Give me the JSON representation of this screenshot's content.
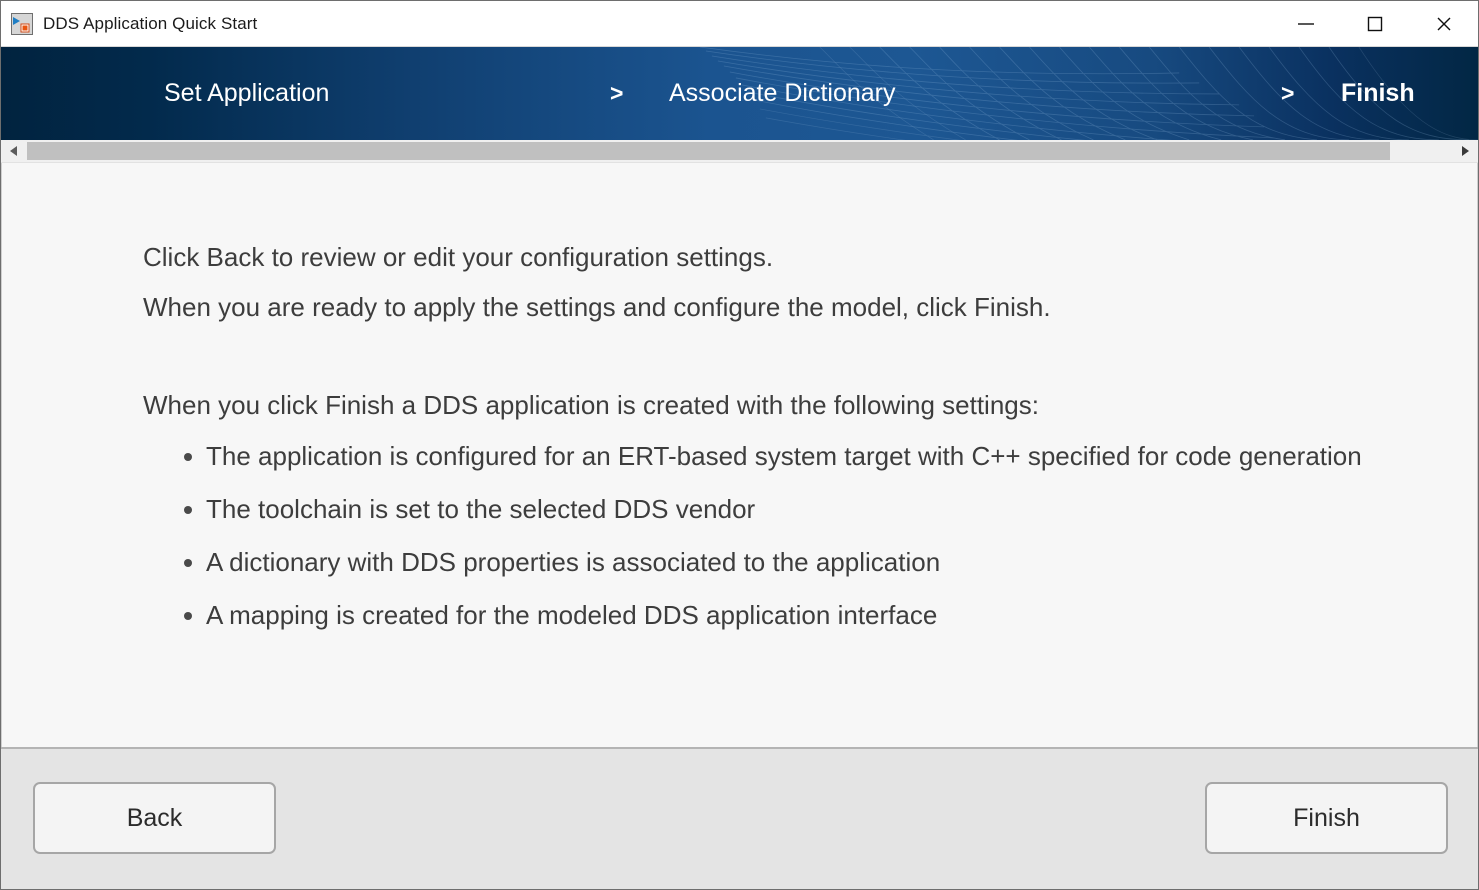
{
  "window": {
    "title": "DDS Application Quick Start",
    "icon": "simulink-block-icon",
    "controls": [
      {
        "name": "minimize-button",
        "label": "—"
      },
      {
        "name": "maximize-button",
        "label": "□"
      },
      {
        "name": "close-button",
        "label": "✕"
      }
    ]
  },
  "banner": {
    "steps": [
      {
        "label": "Set Application",
        "active": false
      },
      {
        "label": "Associate Dictionary",
        "active": false
      },
      {
        "label": "Finish",
        "active": true
      }
    ],
    "separator": ">",
    "gradient_dark": "#012a4a",
    "gradient_mid": "#1b5490"
  },
  "scrollbar": {
    "left_arrow": "◀",
    "right_arrow": "▶",
    "orientation": "horizontal"
  },
  "content": {
    "paragraph1_line1": "Click Back to review or edit your configuration settings.",
    "paragraph1_line2": "When you are ready to apply the settings and configure the model, click Finish.",
    "paragraph2": "When you click Finish a DDS application is created with the following settings:",
    "bullets": [
      "The application is configured for an ERT-based system target with C++ specified for code generation",
      "The toolchain is set to the selected DDS vendor",
      "A dictionary with DDS properties is associated to the application",
      "A mapping is created for the modeled DDS application interface"
    ],
    "text_color": "#3d3d3d",
    "background": "#f7f7f7"
  },
  "footer": {
    "back_label": "Back",
    "finish_label": "Finish",
    "background": "#e4e4e4"
  }
}
